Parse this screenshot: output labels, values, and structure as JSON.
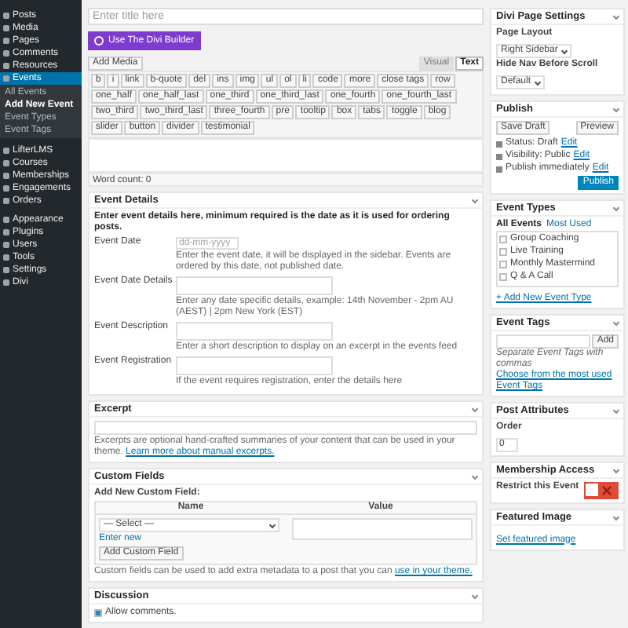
{
  "admin_menu": [
    {
      "label": "Posts",
      "selected": false
    },
    {
      "label": "Media",
      "selected": false
    },
    {
      "label": "Pages",
      "selected": false
    },
    {
      "label": "Comments",
      "selected": false
    },
    {
      "label": "Resources",
      "selected": false
    },
    {
      "label": "Events",
      "selected": true,
      "children": [
        {
          "label": "All Events",
          "selected": false
        },
        {
          "label": "Add New Event",
          "selected": true
        },
        {
          "label": "Event Types",
          "selected": false
        },
        {
          "label": "Event Tags",
          "selected": false
        }
      ]
    },
    {
      "label": "LifterLMS",
      "selected": false
    },
    {
      "label": "Courses",
      "selected": false
    },
    {
      "label": "Memberships",
      "selected": false
    },
    {
      "label": "Engagements",
      "selected": false
    },
    {
      "label": "Orders",
      "selected": false
    },
    {
      "label": "Appearance",
      "selected": false
    },
    {
      "label": "Plugins",
      "selected": false
    },
    {
      "label": "Users",
      "selected": false
    },
    {
      "label": "Tools",
      "selected": false
    },
    {
      "label": "Settings",
      "selected": false
    },
    {
      "label": "Divi",
      "selected": false
    }
  ],
  "title_field": {
    "placeholder": "Enter title here"
  },
  "divi_button": "Use The Divi Builder",
  "editor": {
    "add_media": "Add Media",
    "tabs": [
      {
        "label": "Visual",
        "selected": false
      },
      {
        "label": "Text",
        "selected": true
      }
    ],
    "quicktags": [
      "b",
      "i",
      "link",
      "b-quote",
      "del",
      "ins",
      "img",
      "ul",
      "ol",
      "li",
      "code",
      "more",
      "close tags",
      "row",
      "one_half",
      "one_half_last",
      "one_third",
      "one_third_last",
      "one_fourth",
      "one_fourth_last",
      "two_third",
      "two_third_last",
      "three_fourth",
      "pre",
      "tooltip",
      "box",
      "tabs",
      "toggle",
      "blog",
      "slider",
      "button",
      "divider",
      "testimonial"
    ],
    "word_count": "Word count: 0"
  },
  "event_details": {
    "title": "Event Details",
    "intro": "Enter event details here, minimum required is the date as it is used for ordering posts.",
    "fields": [
      {
        "kind": "input",
        "label": "Event Date",
        "placeholder": "dd-mm-yyyy",
        "hint": "Enter the event date, it will be displayed in the sidebar. Events are ordered by this date, not published date."
      },
      {
        "kind": "textarea",
        "label": "Event Date Details",
        "hint": "Enter any date specific details, example: 14th November - 2pm AU (AEST) | 2pm New York (EST)"
      },
      {
        "kind": "textarea",
        "label": "Event Description",
        "hint": "Enter a short description to display on an excerpt in the events feed"
      },
      {
        "kind": "textarea",
        "label": "Event Registration",
        "hint": "If the event requires registration, enter the details here"
      }
    ]
  },
  "excerpt": {
    "title": "Excerpt",
    "note": "Excerpts are optional hand-crafted summaries of your content that can be used in your theme.",
    "link": "Learn more about manual excerpts."
  },
  "custom_fields": {
    "title": "Custom Fields",
    "heading": "Add New Custom Field:",
    "columns": [
      "Name",
      "Value"
    ],
    "select": "— Select —",
    "enter_new": "Enter new",
    "add_button": "Add Custom Field",
    "note": "Custom fields can be used to add extra metadata to a post that you can",
    "link": "use in your theme."
  },
  "discussion": {
    "title": "Discussion",
    "options": [
      {
        "label": "Allow comments.",
        "checked": true
      }
    ]
  },
  "divi_settings": {
    "title": "Divi Page Settings",
    "rows": [
      {
        "label": "Page Layout",
        "value": "Right Sidebar"
      },
      {
        "label": "Hide Nav Before Scroll",
        "value": "Default"
      }
    ]
  },
  "publish": {
    "title": "Publish",
    "save": "Save Draft",
    "preview": "Preview",
    "lines": [
      {
        "text": "Status: Draft",
        "link": "Edit"
      },
      {
        "text": "Visibility: Public",
        "link": "Edit"
      },
      {
        "text": "Publish immediately",
        "link": "Edit"
      }
    ],
    "button": "Publish"
  },
  "event_types": {
    "title": "Event Types",
    "tabs": [
      {
        "label": "All Events",
        "selected": true
      },
      {
        "label": "Most Used",
        "selected": false
      }
    ],
    "items": [
      {
        "label": "Group Coaching",
        "checked": false
      },
      {
        "label": "Live Training",
        "checked": false
      },
      {
        "label": "Monthly Mastermind",
        "checked": false
      },
      {
        "label": "Q & A Call",
        "checked": false
      }
    ],
    "add": "+ Add New Event Type"
  },
  "event_tags": {
    "title": "Event Tags",
    "add": "Add",
    "note": "Separate Event Tags with commas",
    "link": "Choose from the most used Event Tags"
  },
  "post_attributes": {
    "title": "Post Attributes",
    "label": "Order",
    "value": "0"
  },
  "membership_access": {
    "title": "Membership Access",
    "label": "Restrict this Event",
    "on": false
  },
  "featured_image": {
    "title": "Featured Image",
    "link": "Set featured image"
  }
}
